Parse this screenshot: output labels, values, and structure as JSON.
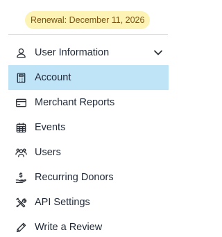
{
  "renewal": {
    "label": "Renewal: December 11, 2026",
    "bg_color": "#fdf3b5",
    "text_color": "#7a5410"
  },
  "accent": {
    "active_bg": "#bfe3f7"
  },
  "nav": {
    "items": [
      {
        "label": "User Information",
        "icon": "user-icon",
        "expandable": true,
        "active": false
      },
      {
        "label": "Account",
        "icon": "calculator-icon",
        "active": true
      },
      {
        "label": "Merchant Reports",
        "icon": "credit-card-icon",
        "active": false
      },
      {
        "label": "Events",
        "icon": "calendar-icon",
        "active": false
      },
      {
        "label": "Users",
        "icon": "users-icon",
        "active": false
      },
      {
        "label": "Recurring Donors",
        "icon": "hand-coin-icon",
        "active": false
      },
      {
        "label": "API Settings",
        "icon": "tools-icon",
        "active": false
      },
      {
        "label": "Write a Review",
        "icon": "pencil-icon",
        "active": false
      }
    ]
  }
}
